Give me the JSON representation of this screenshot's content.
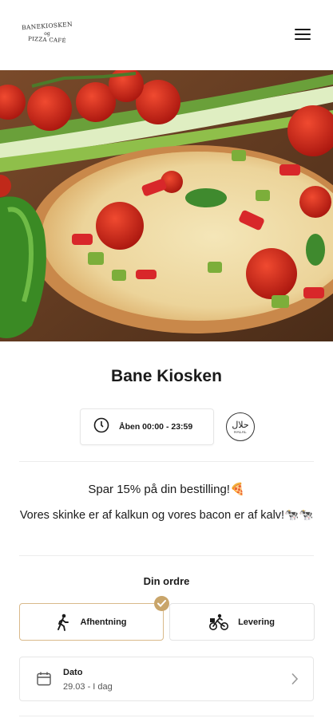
{
  "header": {
    "logo_line1": "BANEKIOSKEN",
    "logo_line2": "og",
    "logo_line3": "PIZZA CAFÉ"
  },
  "shop": {
    "name": "Bane Kiosken",
    "hours": "Åben 00:00 - 23:59",
    "halal_ar": "حلال",
    "halal_en": "HALAL"
  },
  "promo": {
    "line1": "Spar 15% på din bestilling!🍕",
    "line2": "Vores skinke er af kalkun og vores bacon er af kalv!🐄🐄"
  },
  "order": {
    "title": "Din ordre",
    "pickup_label": "Afhentning",
    "delivery_label": "Levering",
    "selected": "pickup",
    "date_label": "Dato",
    "date_value": "29.03 - I dag"
  },
  "colors": {
    "accent": "#c9a56a",
    "accent_border": "#d9b98a"
  }
}
